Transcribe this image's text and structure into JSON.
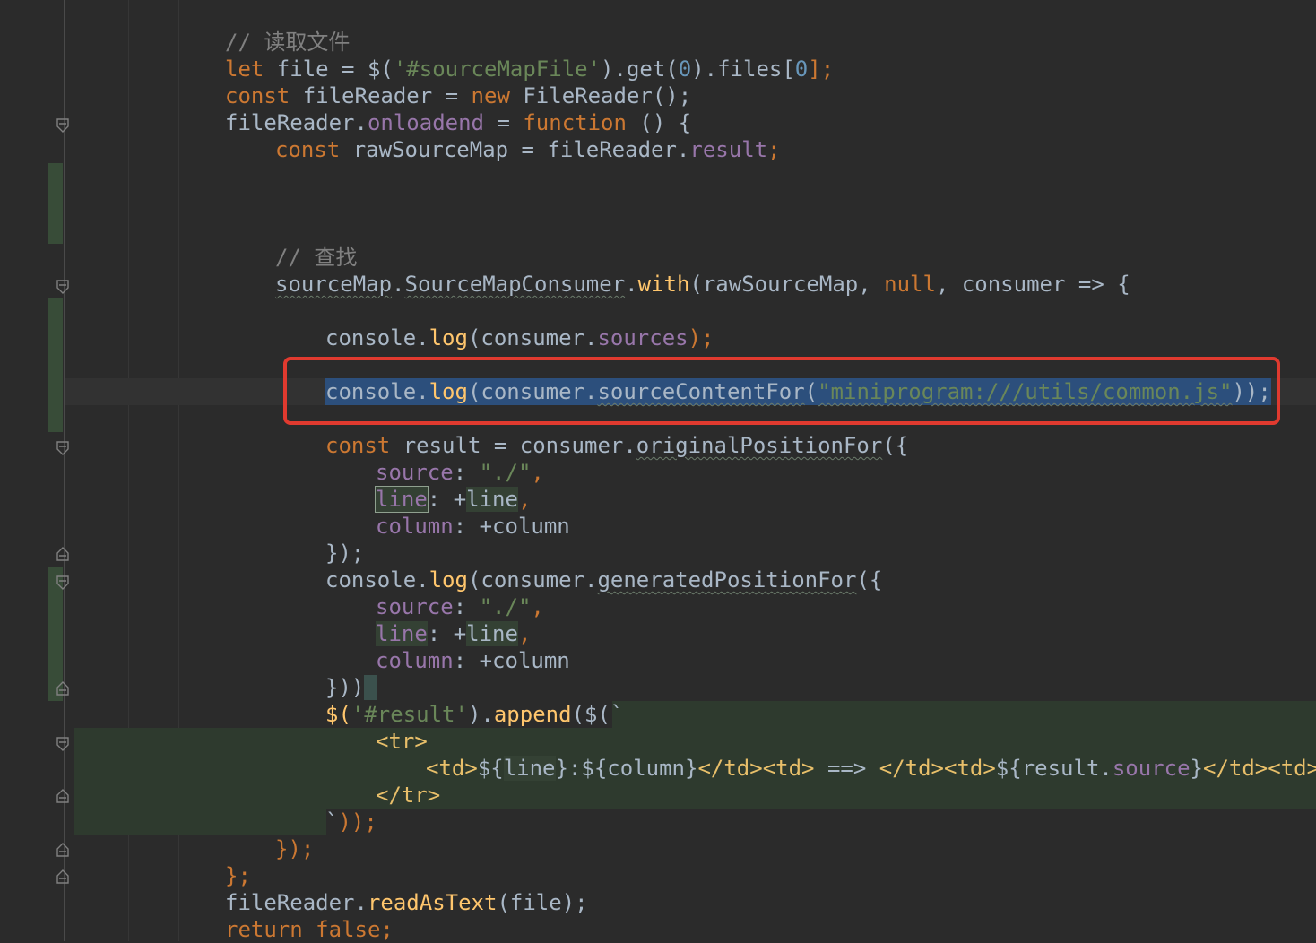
{
  "editor": {
    "theme": "Darcula",
    "language": "JavaScript",
    "highlight_color": "#e03a2f",
    "selected_line_index": 13
  },
  "lines": {
    "l0": "// 读取文件",
    "l1_kw": "let",
    "l1_rest": " file = $(",
    "l1_str": "'#sourceMapFile'",
    "l1_get": ").get(",
    "l1_num": "0",
    "l1_files": ").files[",
    "l1_num2": "0",
    "l1_end": "];",
    "l2_kw": "const",
    "l2_rest": " fileReader = ",
    "l2_new": "new",
    "l2_end": " FileReader();",
    "l3_obj": "fileReader.",
    "l3_prop": "onloadend",
    "l3_eq": " = ",
    "l3_fn": "function",
    "l3_end": " () {",
    "l4_kw": "const",
    "l4_rest": " rawSourceMap = fileReader.",
    "l4_prop": "result",
    "l4_end": ";",
    "l5": "// 查找",
    "l6_obj": "sourceMap",
    "l6_dot": ".",
    "l6_cls": "SourceMapConsumer",
    "l6_dot2": ".",
    "l6_fn": "with",
    "l6_args": "(rawSourceMap, ",
    "l6_null": "null",
    "l6_end": ", consumer => {",
    "l7_obj": "console.",
    "l7_fn": "log",
    "l7_arg": "(consumer.",
    "l7_prop": "sources",
    "l7_end": ");",
    "l8_obj": "console.",
    "l8_fn": "log",
    "l8_arg": "(consumer.",
    "l8_method": "sourceContentFor",
    "l8_paren": "(",
    "l8_str": "\"miniprogram:///utils/common.js\"",
    "l8_end": "));",
    "l9_kw": "const",
    "l9_rest": " result = consumer.",
    "l9_method": "originalPositionFor",
    "l9_end": "({",
    "l10_prop": "source",
    "l10_colon": ": ",
    "l10_str": "\"./\"",
    "l10_comma": ",",
    "l11_prop": "line",
    "l11_mid": ": +",
    "l11_var": "line",
    "l11_comma": ",",
    "l12_prop": "column",
    "l12_rest": ": +column",
    "l13": "});",
    "l14_obj": "console.",
    "l14_fn": "log",
    "l14_arg": "(consumer.",
    "l14_method": "generatedPositionFor",
    "l14_end": "({",
    "l15_prop": "source",
    "l15_colon": ": ",
    "l15_str": "\"./\"",
    "l15_comma": ",",
    "l16_prop": "line",
    "l16_mid": ": +",
    "l16_var": "line",
    "l16_comma": ",",
    "l17_prop": "column",
    "l17_rest": ": +column",
    "l18": "}))",
    "l19_a": "$(",
    "l19_str": "'#result'",
    "l19_b": ").",
    "l19_fn": "append",
    "l19_c": "($(`",
    "l20": "<tr>",
    "l21_td1": "<td>",
    "l21_a": "${",
    "l21_line": "line",
    "l21_b": "}:${column}",
    "l21_td2": "</td><td>",
    "l21_arrow": " ==> ",
    "l21_td3": "</td><td>",
    "l21_c": "${result.",
    "l21_src": "source",
    "l21_d": "}",
    "l21_td4": "</td><td>",
    "l21_e": "${",
    "l22": "</tr>",
    "l23_a": "`",
    "l23_b": "));",
    "l24": "});",
    "l25": "};",
    "l26_obj": "fileReader.",
    "l26_fn": "readAsText",
    "l26_end": "(file);",
    "l27_kw": "return",
    "l27_sp": " ",
    "l27_false": "false",
    "l27_end": ";"
  }
}
